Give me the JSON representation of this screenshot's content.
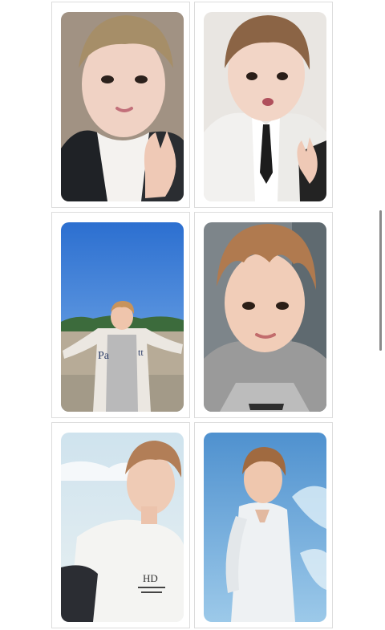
{
  "gallery": {
    "cards": [
      {
        "name": "photocard-1"
      },
      {
        "name": "photocard-2"
      },
      {
        "name": "photocard-3"
      },
      {
        "name": "photocard-4"
      },
      {
        "name": "photocard-5"
      },
      {
        "name": "photocard-6"
      }
    ]
  },
  "colors": {
    "cell_border": "#dcdcdc",
    "sky_blue": "#3f7fd1",
    "hair_brown": "#9a6a44",
    "skin": "#f3d3c2",
    "scrollbar": "#8a8a8a"
  },
  "card6_logo_text": "HD"
}
